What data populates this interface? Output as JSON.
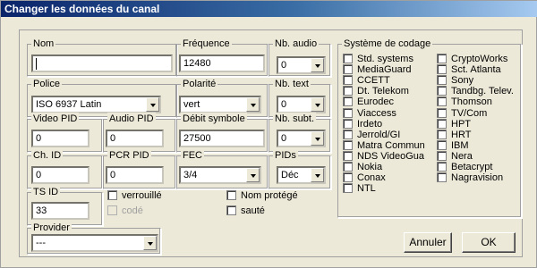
{
  "window": {
    "title": "Changer les données du canal"
  },
  "nom": {
    "label": "Nom",
    "value": ""
  },
  "frequence": {
    "label": "Fréquence",
    "value": "12480"
  },
  "nb_audio": {
    "label": "Nb. audio",
    "value": "0"
  },
  "police": {
    "label": "Police",
    "value": "ISO 6937 Latin"
  },
  "polarite": {
    "label": "Polarité",
    "value": "vert"
  },
  "nb_text": {
    "label": "Nb. text",
    "value": "0"
  },
  "video_pid": {
    "label": "Video PID",
    "value": "0"
  },
  "audio_pid": {
    "label": "Audio PID",
    "value": "0"
  },
  "debit_symbole": {
    "label": "Débit symbole",
    "value": "27500"
  },
  "nb_subt": {
    "label": "Nb. subt.",
    "value": "0"
  },
  "ch_id": {
    "label": "Ch. ID",
    "value": "0"
  },
  "pcr_pid": {
    "label": "PCR PID",
    "value": "0"
  },
  "fec": {
    "label": "FEC",
    "value": "3/4"
  },
  "pids": {
    "label": "PIDs",
    "value": "Déc"
  },
  "ts_id": {
    "label": "TS ID",
    "value": "33"
  },
  "flags": {
    "verrouille": "verrouillé",
    "code": "codé",
    "nom_protege": "Nom protégé",
    "saute": "sauté"
  },
  "provider": {
    "label": "Provider",
    "value": "---"
  },
  "systeme": {
    "label": "Système de codage",
    "left": [
      "Std. systems",
      "MediaGuard",
      "CCETT",
      "Dt. Telekom",
      "Eurodec",
      "Viaccess",
      "Irdeto",
      "Jerrold/GI",
      "Matra Commun",
      "NDS VideoGua",
      "Nokia",
      "Conax",
      "NTL"
    ],
    "right": [
      "CryptoWorks",
      "Sct. Atlanta",
      "Sony",
      "Tandbg. Telev.",
      "Thomson",
      "TV/Com",
      "HPT",
      "HRT",
      "IBM",
      "Nera",
      "Betacrypt",
      "Nagravision"
    ]
  },
  "buttons": {
    "annuler": "Annuler",
    "ok": "OK"
  }
}
